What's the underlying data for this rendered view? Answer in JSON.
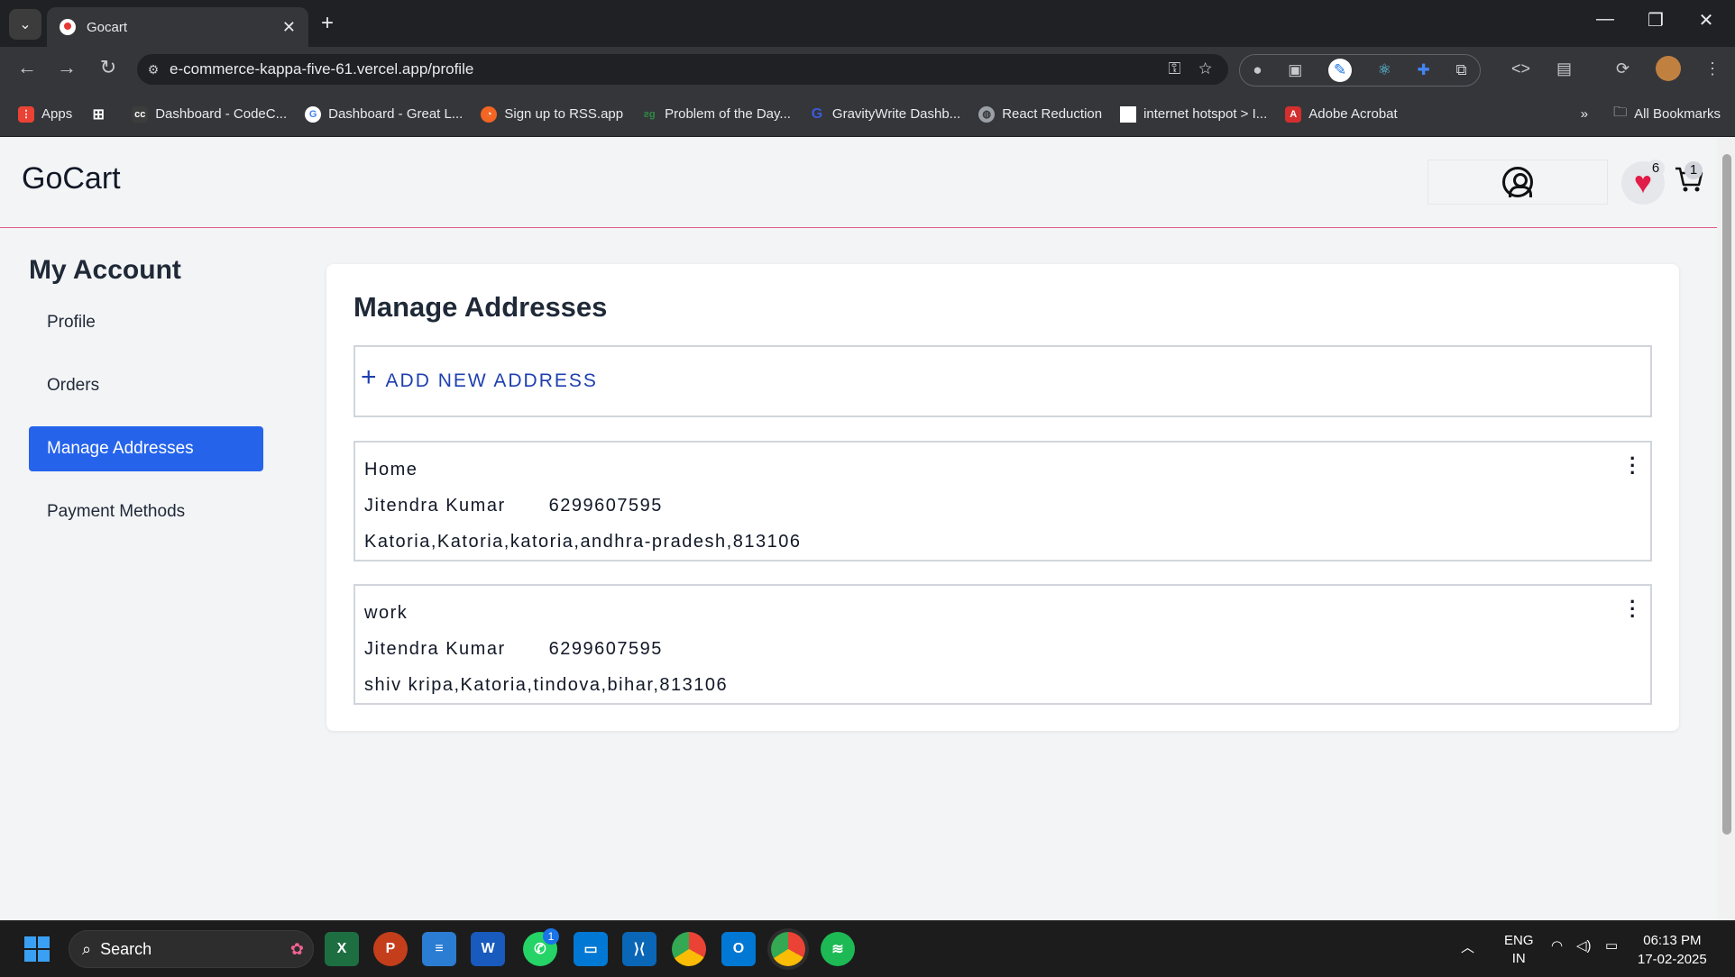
{
  "browser": {
    "tab_title": "Gocart",
    "url": "e-commerce-kappa-five-61.vercel.app/profile",
    "bookmarks": [
      {
        "label": "Apps",
        "icon": "apps-grid-icon",
        "color": "#ea4335"
      },
      {
        "label": "",
        "icon": "grid-icon",
        "color": "#5f6368"
      },
      {
        "label": "Dashboard - CodeC...",
        "icon": "codechef-icon",
        "color": "#3c3c3c"
      },
      {
        "label": "Dashboard - Great L...",
        "icon": "google-icon",
        "color": "#4285f4"
      },
      {
        "label": "Sign up to RSS.app",
        "icon": "rss-icon",
        "color": "#f26522"
      },
      {
        "label": "Problem of the Day...",
        "icon": "gfg-icon",
        "color": "#2f8d46"
      },
      {
        "label": "GravityWrite Dashb...",
        "icon": "gravitywrite-icon",
        "color": "#3b5bdb"
      },
      {
        "label": "React Reduction",
        "icon": "globe-icon",
        "color": "#9aa0a6"
      },
      {
        "label": "internet hotspot > I...",
        "icon": "page-icon",
        "color": "#ffffff"
      },
      {
        "label": "Adobe Acrobat",
        "icon": "acrobat-icon",
        "color": "#d32f2f"
      }
    ],
    "all_bookmarks": "All Bookmarks"
  },
  "header": {
    "logo": "GoCart",
    "wishlist_count": "6",
    "cart_count": "1"
  },
  "sidebar": {
    "title": "My Account",
    "items": [
      {
        "label": "Profile",
        "active": false
      },
      {
        "label": "Orders",
        "active": false
      },
      {
        "label": "Manage Addresses",
        "active": true
      },
      {
        "label": "Payment Methods",
        "active": false
      }
    ]
  },
  "main": {
    "title": "Manage Addresses",
    "add_label": "ADD NEW ADDRESS",
    "addresses": [
      {
        "type": "Home",
        "name": "Jitendra Kumar",
        "phone": "6299607595",
        "address": "Katoria,Katoria,katoria,andhra-pradesh,813106"
      },
      {
        "type": "work",
        "name": "Jitendra Kumar",
        "phone": "6299607595",
        "address": "shiv kripa,Katoria,tindova,bihar,813106"
      }
    ]
  },
  "taskbar": {
    "search_placeholder": "Search",
    "whatsapp_badge": "1",
    "language": "ENG",
    "region": "IN",
    "time": "06:13 PM",
    "date": "17-02-2025"
  },
  "colors": {
    "accent": "#2563eb",
    "add_link": "#1e40af",
    "header_border": "#e05a8a"
  }
}
